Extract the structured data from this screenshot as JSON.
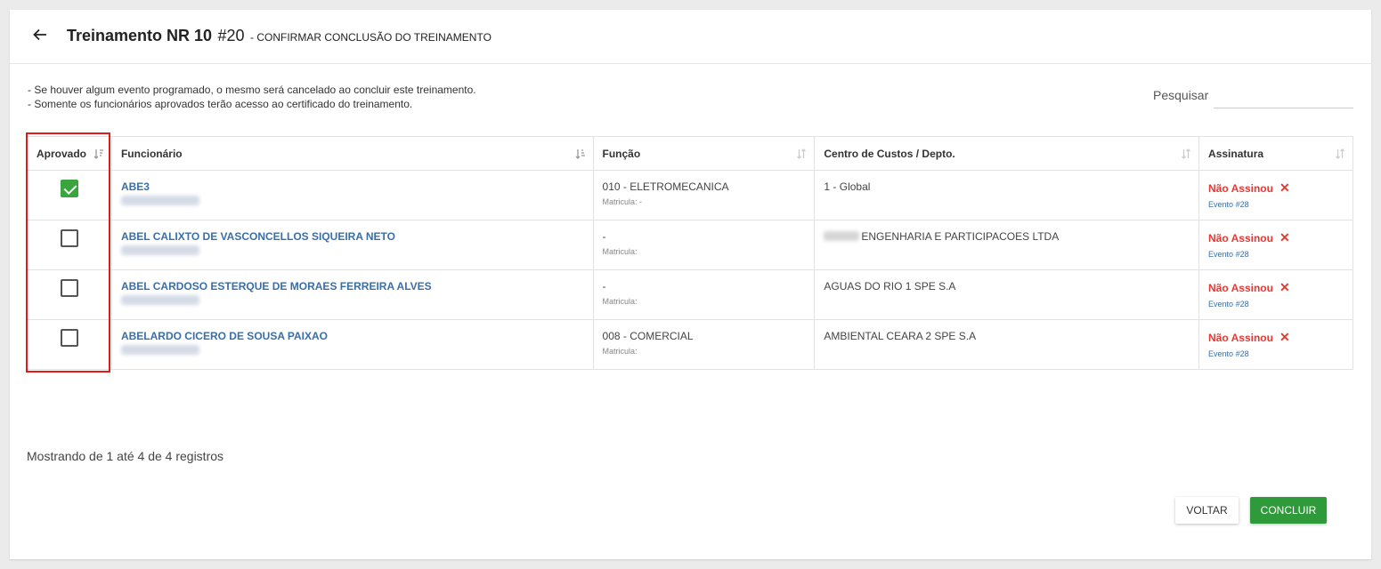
{
  "header": {
    "title": "Treinamento NR 10",
    "number": "#20",
    "subtitle": "- CONFIRMAR CONCLUSÃO DO TREINAMENTO"
  },
  "notes": [
    "- Se houver algum evento programado, o mesmo será cancelado ao concluir este treinamento.",
    "- Somente os funcionários aprovados terão acesso ao certificado do treinamento."
  ],
  "search": {
    "label": "Pesquisar",
    "value": ""
  },
  "table": {
    "columns": [
      "Aprovado",
      "Funcionário",
      "Função",
      "Centro de Custos / Depto.",
      "Assinatura"
    ],
    "rows": [
      {
        "approved": true,
        "name": "ABE3",
        "funcao": "010 - ELETROMECANICA",
        "matricula": "Matricula: -",
        "cc": "1 - Global",
        "cc_blurred": false,
        "signature": "Não Assinou",
        "event": "Evento #28"
      },
      {
        "approved": false,
        "name": "ABEL CALIXTO DE VASCONCELLOS SIQUEIRA NETO",
        "funcao": "-",
        "matricula": "Matricula:",
        "cc": "ENGENHARIA E PARTICIPACOES LTDA",
        "cc_blurred": true,
        "signature": "Não Assinou",
        "event": "Evento #28"
      },
      {
        "approved": false,
        "name": "ABEL CARDOSO ESTERQUE DE MORAES FERREIRA ALVES",
        "funcao": "-",
        "matricula": "Matricula:",
        "cc": "AGUAS DO RIO 1 SPE S.A",
        "cc_blurred": false,
        "signature": "Não Assinou",
        "event": "Evento #28"
      },
      {
        "approved": false,
        "name": "ABELARDO CICERO DE SOUSA PAIXAO",
        "funcao": "008 - COMERCIAL",
        "matricula": "Matricula:",
        "cc": "AMBIENTAL CEARA 2 SPE S.A",
        "cc_blurred": false,
        "signature": "Não Assinou",
        "event": "Evento #28"
      }
    ]
  },
  "footer": {
    "info": "Mostrando de 1 até 4 de 4 registros",
    "back_label": "VOLTAR",
    "conclude_label": "CONCLUIR"
  },
  "colors": {
    "link": "#3a6ea8",
    "danger": "#e53935",
    "success": "#2e9a3a",
    "highlight": "#e01b1b"
  }
}
